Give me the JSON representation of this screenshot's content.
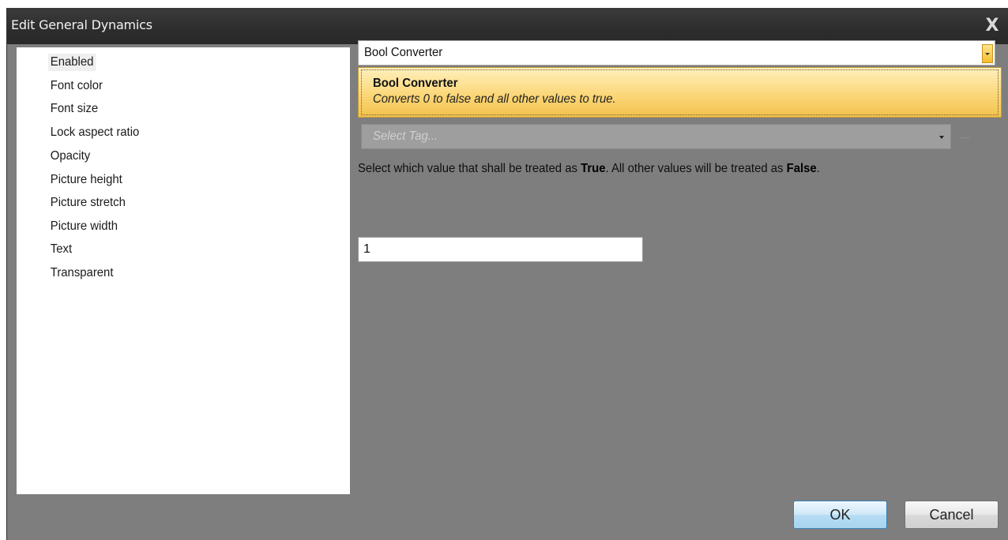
{
  "window": {
    "title": "Edit General Dynamics",
    "close_glyph": "X"
  },
  "properties": {
    "items": [
      {
        "label": "Enabled",
        "selected": true
      },
      {
        "label": "Font color"
      },
      {
        "label": "Font size"
      },
      {
        "label": "Lock aspect ratio"
      },
      {
        "label": "Opacity"
      },
      {
        "label": "Picture height"
      },
      {
        "label": "Picture stretch"
      },
      {
        "label": "Picture width"
      },
      {
        "label": "Text"
      },
      {
        "label": "Transparent"
      }
    ]
  },
  "converter": {
    "selected": "Bool Converter",
    "popup_title": "Bool Converter",
    "popup_description": "Converts 0 to false and all other values to true."
  },
  "tag_select": {
    "placeholder": "Select Tag..."
  },
  "instruction": {
    "part1": "Select which value that shall be treated as ",
    "true_word": "True",
    "part2": ". All other values will be treated as ",
    "false_word": "False",
    "part3": "."
  },
  "true_value": {
    "value": "1"
  },
  "buttons": {
    "ok": "OK",
    "cancel": "Cancel"
  },
  "colors": {
    "titlebar": "#2d2d2d",
    "body": "#7e7e7e",
    "popup_accent": "#fbd779",
    "ok_border": "#3c7fb1"
  }
}
